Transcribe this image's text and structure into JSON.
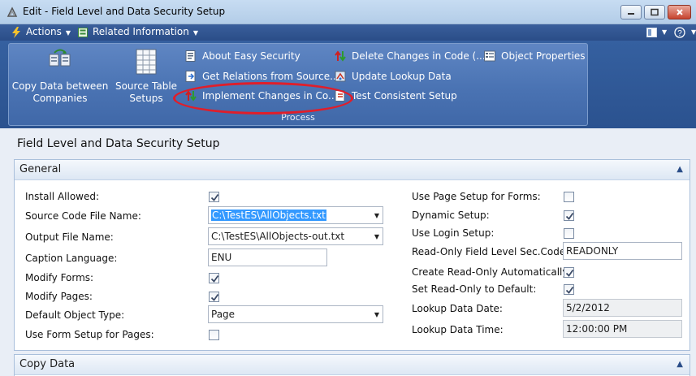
{
  "window": {
    "title": "Edit - Field Level and Data Security Setup"
  },
  "menubar": {
    "actions_label": "Actions",
    "related_label": "Related Information"
  },
  "ribbon": {
    "group_label": "Process",
    "copy_data": "Copy Data between\nCompanies",
    "source_table_setups": "Source Table\nSetups",
    "about_easy_security": "About Easy Security",
    "get_relations": "Get Relations from Source...",
    "implement_changes": "Implement Changes in Co...",
    "delete_changes": "Delete Changes in Code (...",
    "update_lookup": "Update Lookup Data",
    "test_consistent": "Test Consistent Setup",
    "object_properties": "Object Properties"
  },
  "page": {
    "title": "Field Level and Data Security Setup"
  },
  "general": {
    "header": "General",
    "install_allowed_label": "Install Allowed:",
    "install_allowed": true,
    "source_code_file_label": "Source Code File Name:",
    "source_code_file": "C:\\TestES\\AllObjects.txt",
    "output_file_label": "Output File Name:",
    "output_file": "C:\\TestES\\AllObjects-out.txt",
    "caption_language_label": "Caption Language:",
    "caption_language": "ENU",
    "modify_forms_label": "Modify Forms:",
    "modify_forms": true,
    "modify_pages_label": "Modify Pages:",
    "modify_pages": true,
    "default_object_type_label": "Default Object Type:",
    "default_object_type": "Page",
    "use_form_setup_label": "Use Form Setup for Pages:",
    "use_form_setup": false,
    "use_page_setup_label": "Use Page Setup for Forms:",
    "use_page_setup": false,
    "dynamic_setup_label": "Dynamic Setup:",
    "dynamic_setup": true,
    "use_login_setup_label": "Use Login Setup:",
    "use_login_setup": false,
    "readonly_code_label": "Read-Only Field Level Sec.Code:",
    "readonly_code": "READONLY",
    "create_readonly_label": "Create Read-Only Automatically:",
    "create_readonly": true,
    "set_readonly_default_label": "Set Read-Only to Default:",
    "set_readonly_default": true,
    "lookup_date_label": "Lookup Data Date:",
    "lookup_date": "5/2/2012",
    "lookup_time_label": "Lookup Data Time:",
    "lookup_time": "12:00:00 PM"
  },
  "copy_data": {
    "header": "Copy Data"
  },
  "colors": {
    "ribbon": "#2b528f",
    "highlight_ellipse": "#e01e2a",
    "selection": "#3399ff"
  }
}
